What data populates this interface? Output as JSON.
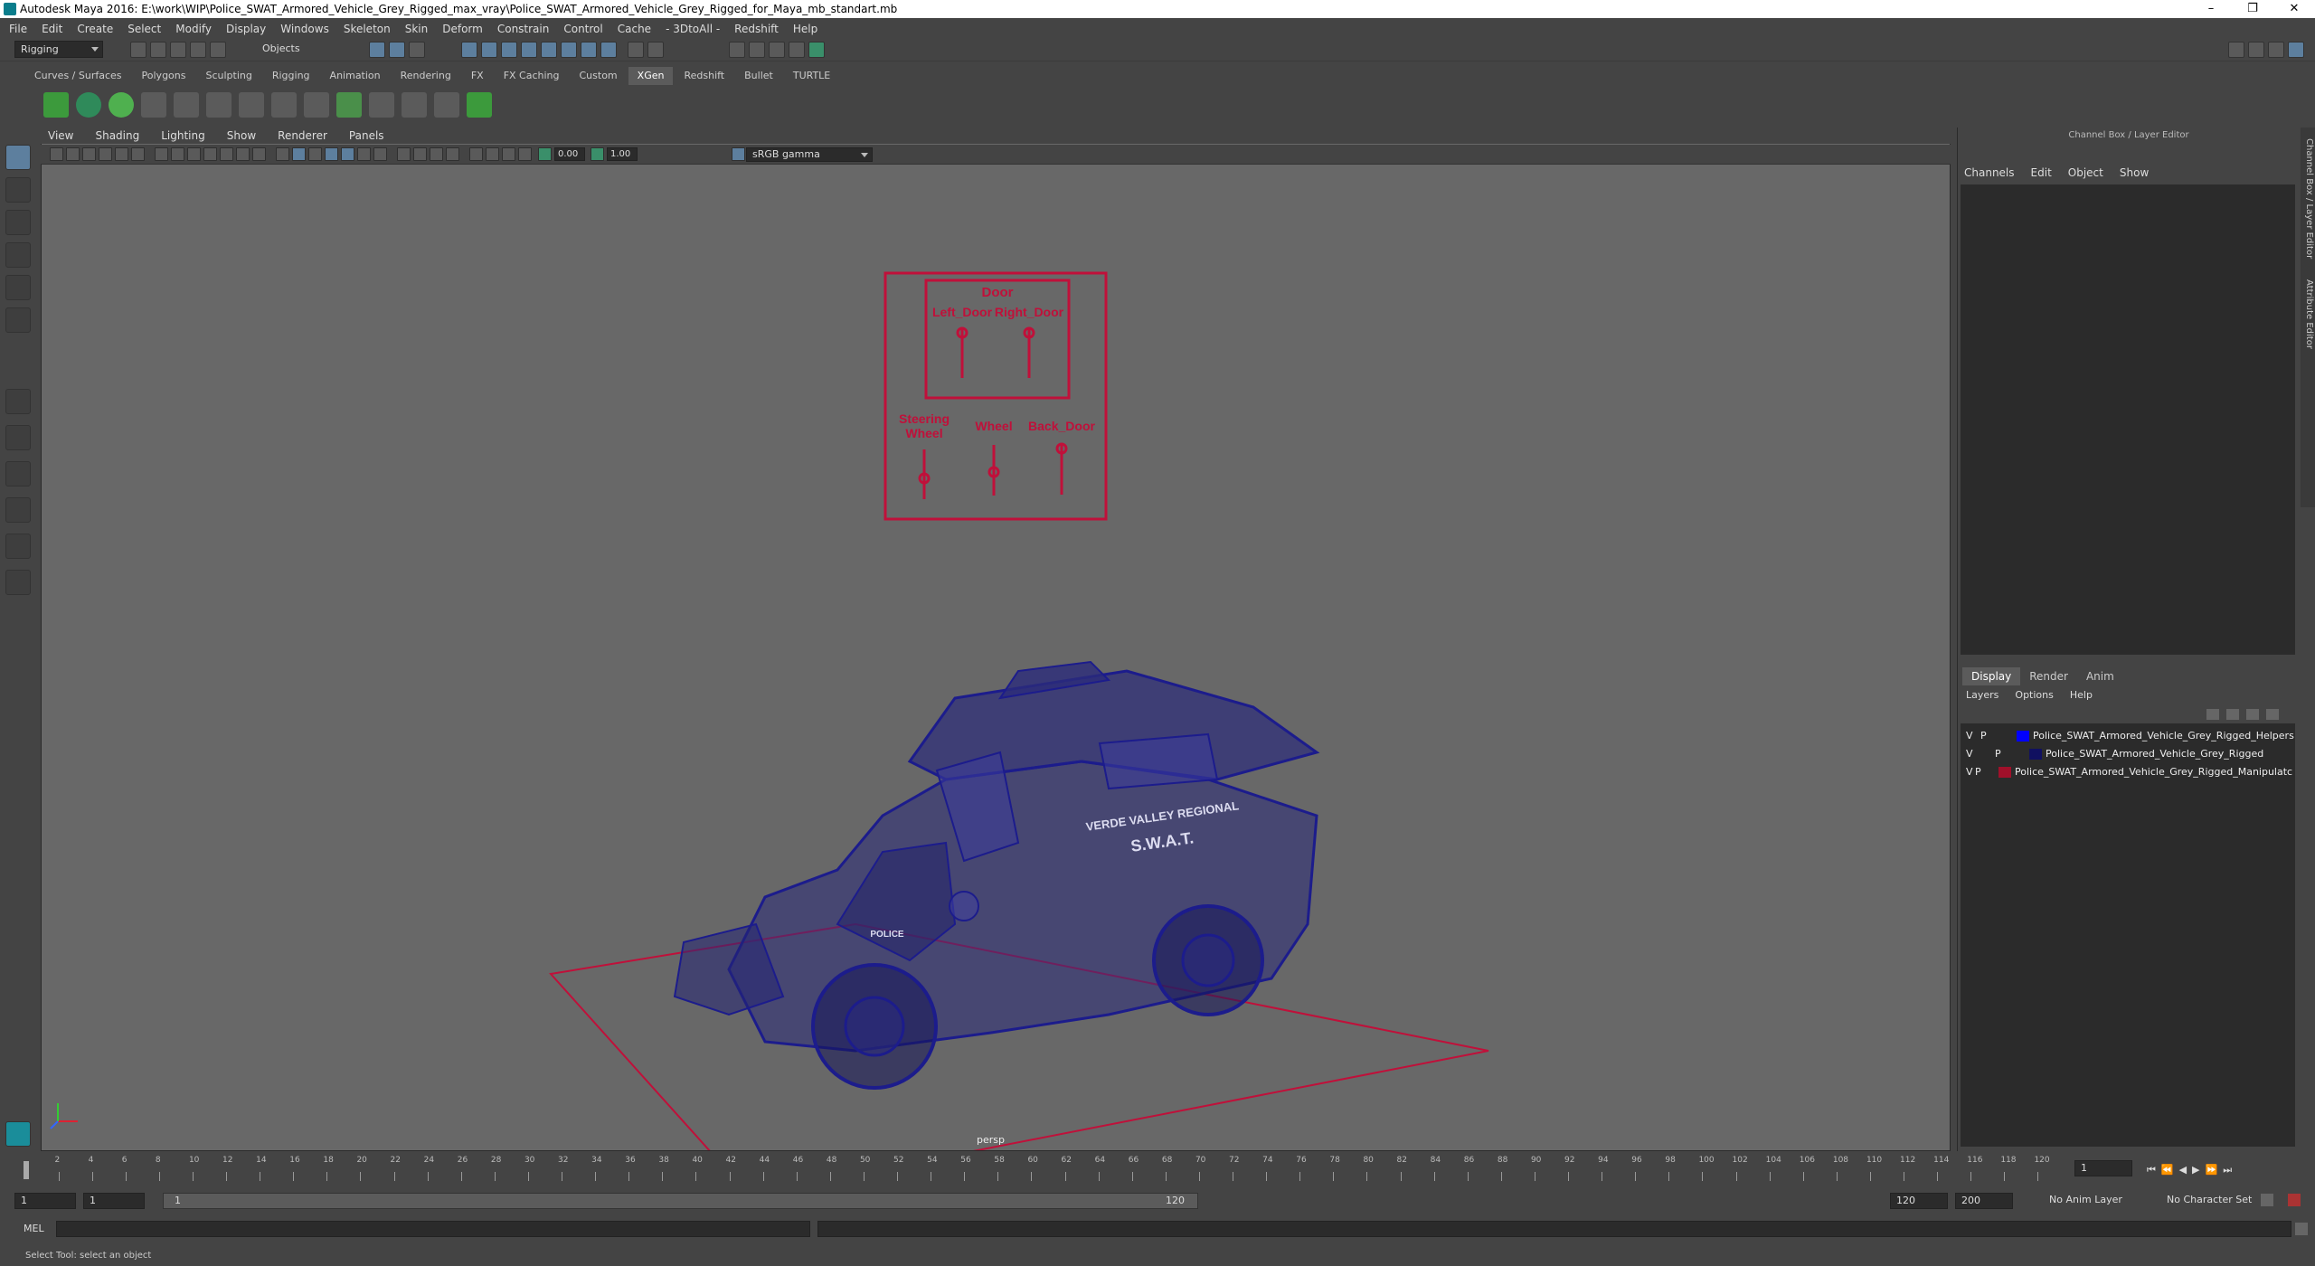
{
  "window": {
    "title": "Autodesk Maya 2016: E:\\work\\WIP\\Police_SWAT_Armored_Vehicle_Grey_Rigged_max_vray\\Police_SWAT_Armored_Vehicle_Grey_Rigged_for_Maya_mb_standart.mb",
    "controls": [
      "–",
      "❐",
      "✕"
    ]
  },
  "menubar": [
    "File",
    "Edit",
    "Create",
    "Select",
    "Modify",
    "Display",
    "Windows",
    "Skeleton",
    "Skin",
    "Deform",
    "Constrain",
    "Control",
    "Cache",
    "- 3DtoAll -",
    "Redshift",
    "Help"
  ],
  "statusline": {
    "menuset": "Rigging",
    "selection_mode": "Objects"
  },
  "shelf_tabs": [
    "Curves / Surfaces",
    "Polygons",
    "Sculpting",
    "Rigging",
    "Animation",
    "Rendering",
    "FX",
    "FX Caching",
    "Custom",
    "XGen",
    "Redshift",
    "Bullet",
    "TURTLE"
  ],
  "active_shelf_tab": "XGen",
  "viewport": {
    "menu": [
      "View",
      "Shading",
      "Lighting",
      "Show",
      "Renderer",
      "Panels"
    ],
    "exposure": "0.00",
    "gamma_value": "1.00",
    "color_space": "sRGB gamma",
    "camera_label": "persp",
    "rig_panel": {
      "title": "Door",
      "left_door": "Left_Door",
      "right_door": "Right_Door",
      "steering": "Steering\nWheel",
      "wheel": "Wheel",
      "back_door": "Back_Door"
    },
    "vehicle_text": {
      "region": "VERDE VALLEY REGIONAL",
      "swat": "S.W.A.T.",
      "police": "POLICE"
    },
    "colors": {
      "wire": "#1c1c8c",
      "rig": "#c0103a",
      "background": "#686868"
    }
  },
  "channel_box": {
    "title": "Channel Box / Layer Editor",
    "menu": [
      "Channels",
      "Edit",
      "Object",
      "Show"
    ]
  },
  "layer_editor": {
    "tabs": [
      "Display",
      "Render",
      "Anim"
    ],
    "active_tab": "Display",
    "menu": [
      "Layers",
      "Options",
      "Help"
    ],
    "layers": [
      {
        "v": "V",
        "p": "P",
        "color": "#0000ff",
        "name": "Police_SWAT_Armored_Vehicle_Grey_Rigged_Helpers"
      },
      {
        "v": "V",
        "p": "P",
        "color": "#101060",
        "name": "Police_SWAT_Armored_Vehicle_Grey_Rigged"
      },
      {
        "v": "V",
        "p": "P",
        "color": "#a0102a",
        "name": "Police_SWAT_Armored_Vehicle_Grey_Rigged_Manipulatc"
      }
    ]
  },
  "side_tabs": [
    "Channel Box / Layer Editor",
    "Attribute Editor"
  ],
  "timeline": {
    "ticks": [
      "2",
      "4",
      "6",
      "8",
      "10",
      "12",
      "14",
      "16",
      "18",
      "20",
      "22",
      "24",
      "26",
      "28",
      "30",
      "32",
      "34",
      "36",
      "38",
      "40",
      "42",
      "44",
      "46",
      "48",
      "50",
      "52",
      "54",
      "56",
      "58",
      "60",
      "62",
      "64",
      "66",
      "68",
      "70",
      "72",
      "74",
      "76",
      "78",
      "80",
      "82",
      "84",
      "86",
      "88",
      "90",
      "92",
      "94",
      "96",
      "98",
      "100",
      "102",
      "104",
      "106",
      "108",
      "110",
      "112",
      "114",
      "116",
      "118",
      "120"
    ],
    "current_frame": "1"
  },
  "range": {
    "start": "1",
    "playback_start": "1",
    "slider_start": "1",
    "slider_end": "120",
    "playback_end": "120",
    "end": "200",
    "anim_layer": "No Anim Layer",
    "character_set": "No Character Set"
  },
  "command_line": {
    "label": "MEL"
  },
  "help_line": "Select Tool: select an object"
}
